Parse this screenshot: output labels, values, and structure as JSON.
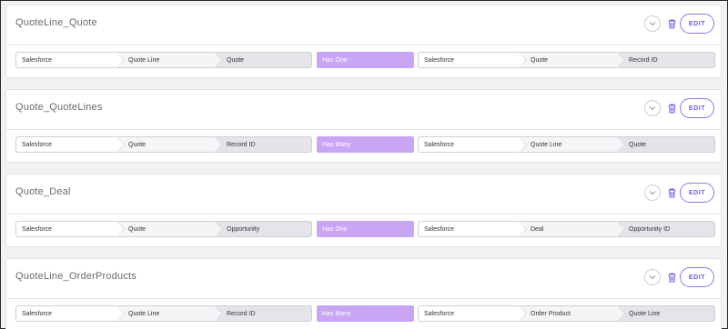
{
  "accent_color": "#6c5ce7",
  "relationship_color": "#c9a6f5",
  "controls": {
    "edit_label": "EDIT",
    "expand_icon": "chevron-down-icon",
    "delete_icon": "trash-icon"
  },
  "mappings": [
    {
      "title": "QuoteLine_Quote",
      "source": [
        "Salesforce",
        "Quote Line",
        "Quote"
      ],
      "relationship": "Has One",
      "target": [
        "Salesforce",
        "Quote",
        "Record ID"
      ]
    },
    {
      "title": "Quote_QuoteLines",
      "source": [
        "Salesforce",
        "Quote",
        "Record ID"
      ],
      "relationship": "Has Many",
      "target": [
        "Salesforce",
        "Quote Line",
        "Quote"
      ]
    },
    {
      "title": "Quote_Deal",
      "source": [
        "Salesforce",
        "Quote",
        "Opportunity"
      ],
      "relationship": "Has One",
      "target": [
        "Salesforce",
        "Deal",
        "Opportunity ID"
      ]
    },
    {
      "title": "QuoteLine_OrderProducts",
      "source": [
        "Salesforce",
        "Quote Line",
        "Record ID"
      ],
      "relationship": "Has Many",
      "target": [
        "Salesforce",
        "Order Product",
        "Quote Line"
      ]
    }
  ]
}
